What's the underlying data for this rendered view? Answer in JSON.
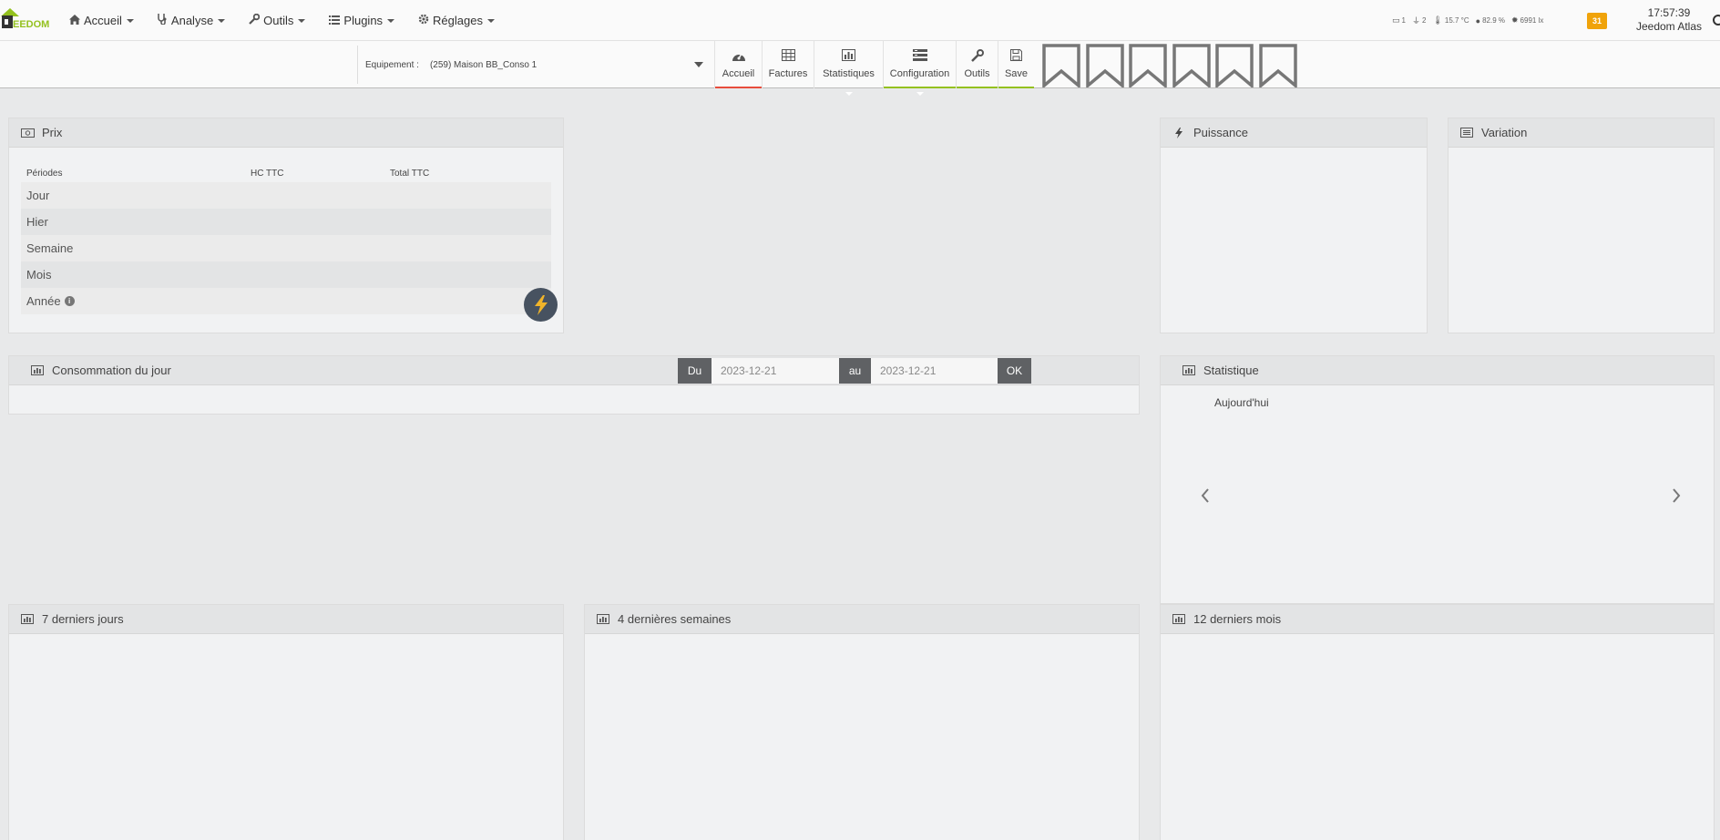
{
  "nav": {
    "logo_text": "EEDOM",
    "menu": [
      {
        "label": "Accueil",
        "icon": "home-icon"
      },
      {
        "label": "Analyse",
        "icon": "stethoscope-icon"
      },
      {
        "label": "Outils",
        "icon": "wrench-icon"
      },
      {
        "label": "Plugins",
        "icon": "list-icon"
      },
      {
        "label": "Réglages",
        "icon": "gear-icon"
      }
    ],
    "status": [
      {
        "icon": "window-icon",
        "value": "1"
      },
      {
        "icon": "plug-icon",
        "value": "2"
      },
      {
        "icon": "thermometer-icon",
        "value": "15.7 °C"
      },
      {
        "icon": "droplet-icon",
        "value": "82.9 %"
      },
      {
        "icon": "sun-icon",
        "value": "6991 lx"
      }
    ],
    "message_count": "31",
    "time": "17:57:39",
    "host": "Jeedom Atlas"
  },
  "subbar": {
    "equip_label": "Equipement :",
    "equip_value": "(259) Maison BB_Conso 1",
    "tabs": [
      {
        "label": "Accueil",
        "icon": "dashboard-icon",
        "underline": "#e74c3c"
      },
      {
        "label": "Factures",
        "icon": "table-icon",
        "underline": ""
      },
      {
        "label": "Statistiques",
        "icon": "bar-chart-icon",
        "underline": ""
      },
      {
        "label": "Configuration",
        "icon": "list-config-icon",
        "underline": "#94c11f"
      },
      {
        "label": "Outils",
        "icon": "wrench-icon",
        "underline": "#94c11f"
      },
      {
        "label": "Save",
        "icon": "floppy-icon",
        "underline": "#94c11f"
      }
    ]
  },
  "panels": {
    "prix": {
      "title": "Prix",
      "headers": [
        "Périodes",
        "HC TTC",
        "Total TTC"
      ],
      "rows": [
        "Jour",
        "Hier",
        "Semaine",
        "Mois",
        "Année"
      ]
    },
    "puissance": {
      "title": "Puissance"
    },
    "variation": {
      "title": "Variation"
    },
    "conso_jour": {
      "title": "Consommation du jour"
    },
    "statistique": {
      "title": "Statistique",
      "today": "Aujourd'hui"
    },
    "sept_jours": {
      "title": "7 derniers jours"
    },
    "quatre_semaines": {
      "title": "4 dernières semaines"
    },
    "douze_mois": {
      "title": "12 derniers mois"
    }
  },
  "daterange": {
    "from_label": "Du",
    "from_value": "2023-12-21",
    "to_label": "au",
    "to_value": "2023-12-21",
    "ok_label": "OK"
  }
}
